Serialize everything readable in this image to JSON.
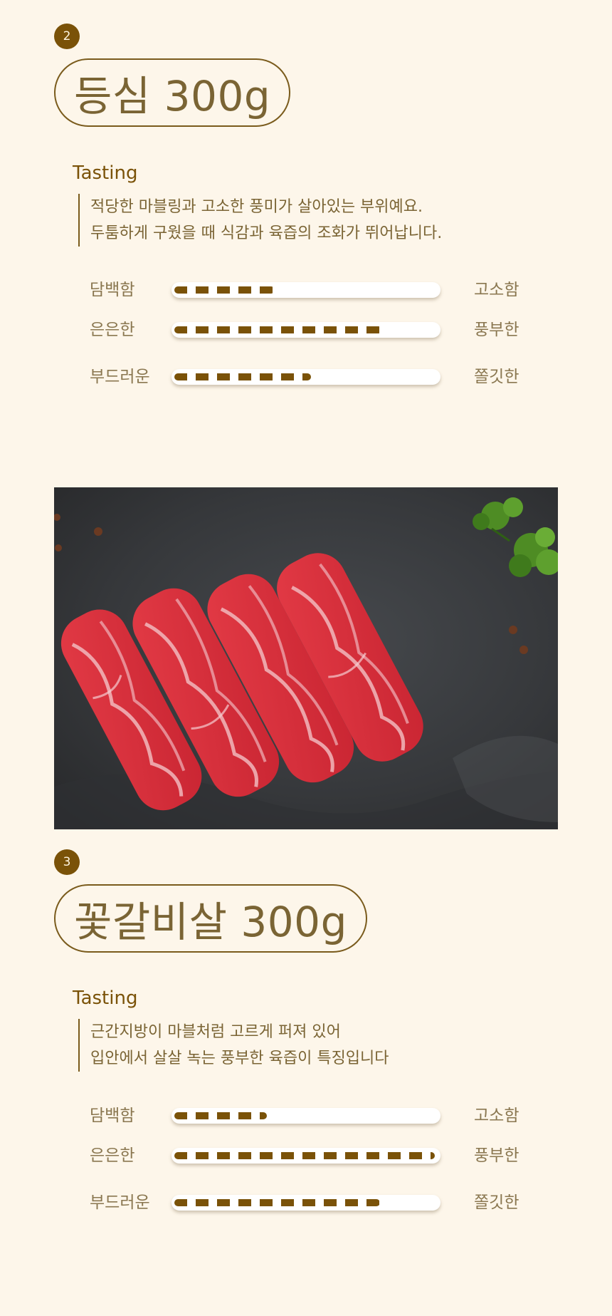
{
  "items": [
    {
      "number": "2",
      "title": "등심 300g",
      "tasting_label": "Tasting",
      "description": [
        "적당한 마블링과 고소한 풍미가 살아있는 부위예요.",
        "두툼하게 구웠을 때 식감과 육즙의 조화가 뛰어납니다."
      ],
      "ratings": [
        {
          "left": "담백함",
          "right": "고소함",
          "level": 0.38
        },
        {
          "left": "은은한",
          "right": "풍부한",
          "level": 0.79
        },
        {
          "left": "부드러운",
          "right": "쫄깃한",
          "level": 0.52
        }
      ]
    },
    {
      "number": "3",
      "title": "꽃갈비살 300g",
      "tasting_label": "Tasting",
      "description": [
        "근간지방이 마블처럼 고르게 퍼져 있어",
        "입안에서 살살 녹는 풍부한 육즙이 특징입니다"
      ],
      "ratings": [
        {
          "left": "담백함",
          "right": "고소함",
          "level": 0.35
        },
        {
          "left": "은은한",
          "right": "풍부한",
          "level": 0.99
        },
        {
          "left": "부드러운",
          "right": "쫄깃한",
          "level": 0.78
        }
      ]
    }
  ],
  "image": {
    "subject": "four-slices-raw-marbled-beef-on-slate",
    "colors": {
      "slate": "#3a3c3f",
      "meat": "#d8303c",
      "marbling": "#f2c0c4",
      "parsley": "#4e8c24"
    }
  },
  "colors": {
    "background": "#fdf6ea",
    "accent": "#7a5208",
    "text": "#7a6434"
  }
}
